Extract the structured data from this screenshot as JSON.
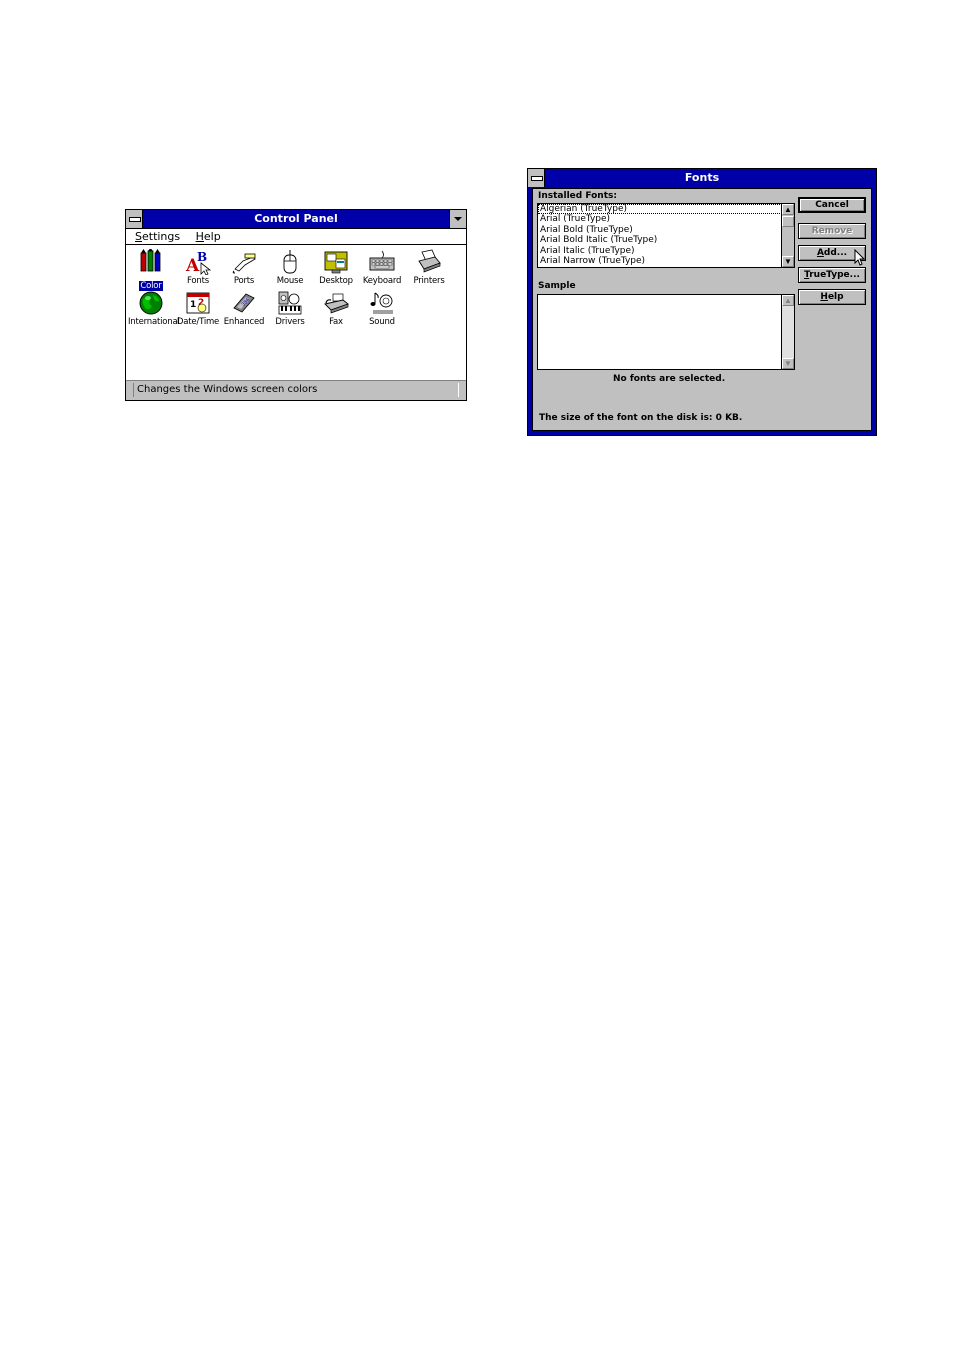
{
  "control_panel": {
    "title": "Control Panel",
    "menu": [
      {
        "label_pre": "",
        "label_ul": "S",
        "label_post": "ettings"
      },
      {
        "label_pre": "",
        "label_ul": "H",
        "label_post": "elp"
      }
    ],
    "icons_row1": [
      {
        "label": "Color",
        "icon": "color-icon",
        "selected": true
      },
      {
        "label": "Fonts",
        "icon": "fonts-icon"
      },
      {
        "label": "Ports",
        "icon": "ports-icon"
      },
      {
        "label": "Mouse",
        "icon": "mouse-icon"
      },
      {
        "label": "Desktop",
        "icon": "desktop-icon"
      },
      {
        "label": "Keyboard",
        "icon": "keyboard-icon"
      },
      {
        "label": "Printers",
        "icon": "printers-icon"
      }
    ],
    "icons_row2": [
      {
        "label": "International",
        "icon": "globe-icon"
      },
      {
        "label": "Date/Time",
        "icon": "calendar-clock-icon"
      },
      {
        "label": "Enhanced",
        "icon": "chip-icon"
      },
      {
        "label": "Drivers",
        "icon": "drivers-icon"
      },
      {
        "label": "Fax",
        "icon": "fax-icon"
      },
      {
        "label": "Sound",
        "icon": "sound-icon"
      }
    ],
    "status": "Changes the Windows screen colors",
    "colors": {
      "title_bar": "#0000a8",
      "selection": "#0000a8"
    }
  },
  "fonts_dialog": {
    "title": "Fonts",
    "installed_label": "Installed Fonts:",
    "fonts": [
      "Algerian (TrueType)",
      "Arial (TrueType)",
      "Arial Bold (TrueType)",
      "Arial Bold Italic (TrueType)",
      "Arial Italic (TrueType)",
      "Arial Narrow (TrueType)"
    ],
    "sample_label": "Sample",
    "no_selection": "No fonts are selected.",
    "size_text": "The size of the font on the disk is:  0 KB.",
    "buttons": {
      "cancel": "Cancel",
      "remove": "Remove",
      "add_ul": "A",
      "add_rest": "dd...",
      "truetype_ul": "T",
      "truetype_rest": "rueType...",
      "help_ul": "H",
      "help_rest": "elp"
    }
  }
}
